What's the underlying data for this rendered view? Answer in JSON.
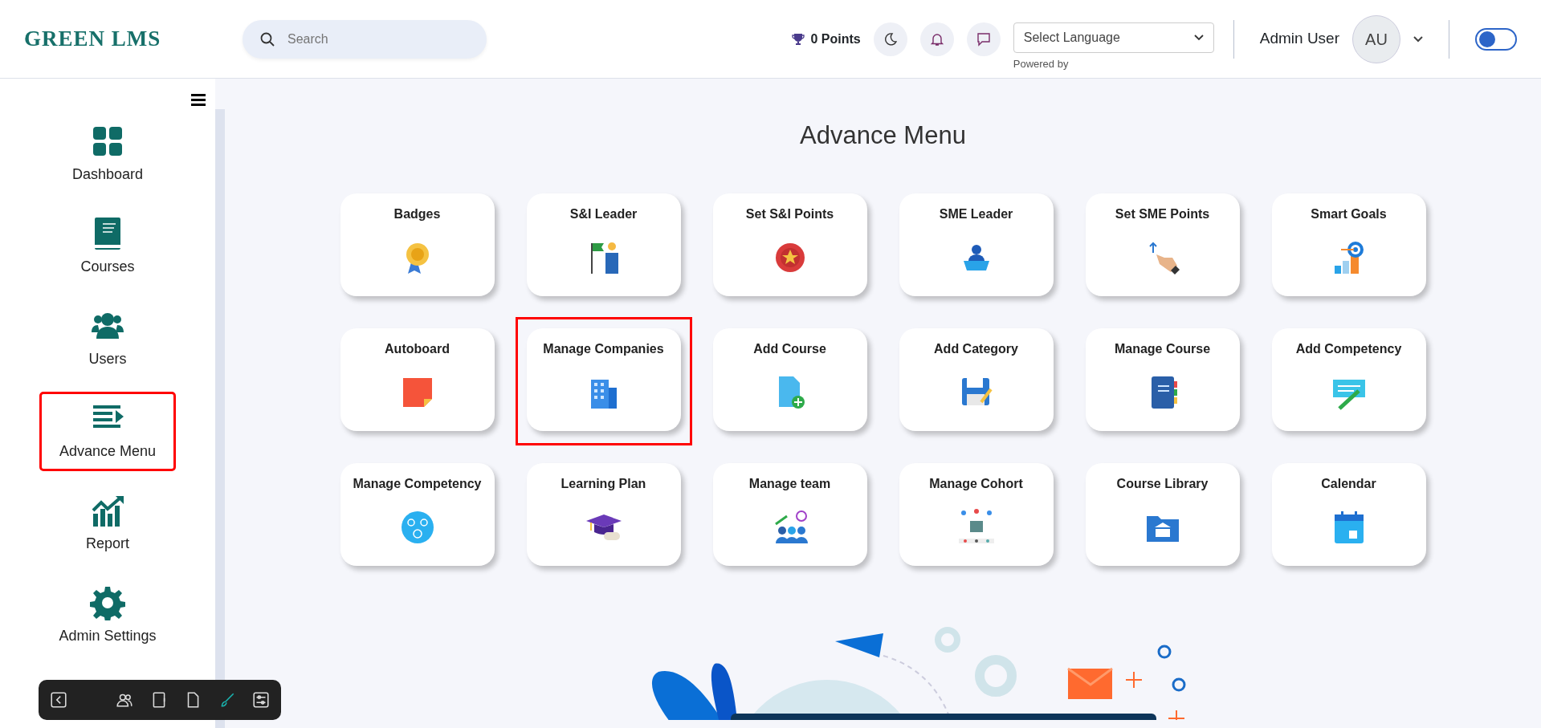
{
  "header": {
    "logo": "GREEN LMS",
    "search": {
      "placeholder": "Search"
    },
    "points": "0 Points",
    "language": {
      "value": "Select Language",
      "note": "Powered by"
    },
    "user": {
      "name": "Admin User",
      "initials": "AU"
    },
    "toggle": {
      "on": false
    }
  },
  "sidebar": {
    "items": [
      {
        "label": "Dashboard",
        "highlighted": false
      },
      {
        "label": "Courses",
        "highlighted": false
      },
      {
        "label": "Users",
        "highlighted": false
      },
      {
        "label": "Advance Menu",
        "highlighted": true
      },
      {
        "label": "Report",
        "highlighted": false
      },
      {
        "label": "Admin Settings",
        "highlighted": false
      }
    ]
  },
  "page": {
    "title": "Advance Menu"
  },
  "cards": [
    {
      "label": "Badges",
      "highlighted": false
    },
    {
      "label": "S&I Leader",
      "highlighted": false
    },
    {
      "label": "Set S&I Points",
      "highlighted": false
    },
    {
      "label": "SME Leader",
      "highlighted": false
    },
    {
      "label": "Set SME Points",
      "highlighted": false
    },
    {
      "label": "Smart Goals",
      "highlighted": false
    },
    {
      "label": "Autoboard",
      "highlighted": false
    },
    {
      "label": "Manage Companies",
      "highlighted": true
    },
    {
      "label": "Add Course",
      "highlighted": false
    },
    {
      "label": "Add Category",
      "highlighted": false
    },
    {
      "label": "Manage Course",
      "highlighted": false
    },
    {
      "label": "Add Competency",
      "highlighted": false
    },
    {
      "label": "Manage Competency",
      "highlighted": false
    },
    {
      "label": "Learning Plan",
      "highlighted": false
    },
    {
      "label": "Manage team",
      "highlighted": false
    },
    {
      "label": "Manage Cohort",
      "highlighted": false
    },
    {
      "label": "Course Library",
      "highlighted": false
    },
    {
      "label": "Calendar",
      "highlighted": false
    }
  ],
  "toolbar": {
    "tools": [
      {
        "selected": false
      },
      {
        "selected": false
      },
      {
        "selected": false
      },
      {
        "selected": false
      },
      {
        "selected": true
      },
      {
        "selected": false
      }
    ]
  }
}
